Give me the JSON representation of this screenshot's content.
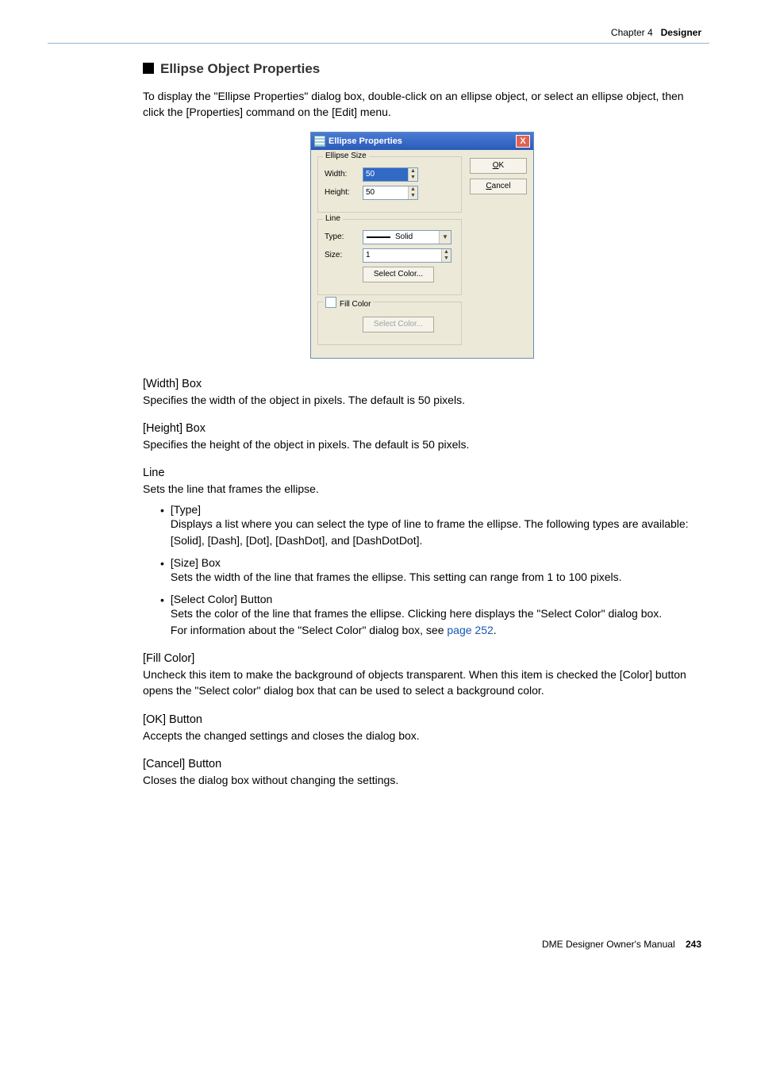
{
  "header": {
    "chapter": "Chapter 4",
    "title": "Designer"
  },
  "section": {
    "title": "Ellipse Object Properties",
    "intro": "To display the \"Ellipse Properties\" dialog box, double-click on an ellipse object, or select an ellipse object, then click the [Properties] command on the [Edit] menu."
  },
  "dialog": {
    "title": "Ellipse Properties",
    "close": "X",
    "ok": "OK",
    "ok_mn": "O",
    "cancel": "Cancel",
    "cancel_mn": "C",
    "groups": {
      "ellipse_size": {
        "legend": "Ellipse Size",
        "width_label": "Width:",
        "width_value": "50",
        "height_label": "Height:",
        "height_value": "50"
      },
      "line": {
        "legend": "Line",
        "type_label": "Type:",
        "type_value": "Solid",
        "size_label": "Size:",
        "size_value": "1",
        "select_color": "Select Color..."
      },
      "fill": {
        "legend": "Fill Color",
        "select_color": "Select Color..."
      }
    }
  },
  "desc": {
    "width_h": "[Width] Box",
    "width_p": "Specifies the width of the object in pixels. The default is 50 pixels.",
    "height_h": "[Height] Box",
    "height_p": "Specifies the height of the object in pixels. The default is 50 pixels.",
    "line_h": "Line",
    "line_p": "Sets the line that frames the ellipse.",
    "type_h": "[Type]",
    "type_p": "Displays a list where you can select the type of line to frame the ellipse. The following types are available: [Solid], [Dash], [Dot], [DashDot], and [DashDotDot].",
    "sizebox_h": "[Size] Box",
    "sizebox_p": "Sets the width of the line that frames the ellipse. This setting can range from 1 to 100 pixels.",
    "selcol_h": "[Select Color] Button",
    "selcol_p1": "Sets the color of the line that frames the ellipse. Clicking here displays the \"Select Color\" dialog box.",
    "selcol_p2a": "For information about the \"Select Color\" dialog box, see ",
    "selcol_link": "page 252",
    "selcol_p2b": ".",
    "fill_h": "[Fill Color]",
    "fill_p": "Uncheck this item to make the background of objects transparent. When this item is checked the [Color] button opens the \"Select color\" dialog box that can be used to select a background color.",
    "ok_h": "[OK] Button",
    "ok_p": "Accepts the changed settings and closes the dialog box.",
    "cancel_h": "[Cancel] Button",
    "cancel_p": "Closes the dialog box without changing the settings."
  },
  "footer": {
    "text": "DME Designer Owner's Manual",
    "page": "243"
  }
}
